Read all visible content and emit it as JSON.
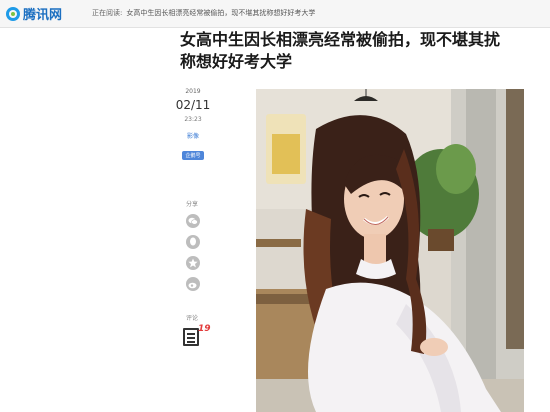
{
  "header": {
    "logo_text": "腾讯网",
    "reading_label": "正在阅读:",
    "reading_title": "女高中生因长相漂亮经常被偷拍，现不堪其扰称想好好考大学"
  },
  "article": {
    "title": "女高中生因长相漂亮经常被偷拍，现不堪其扰称想好好考大学",
    "year": "2019",
    "date": "02/11",
    "time": "23:23",
    "category": "影像",
    "badge": "企鹅号"
  },
  "share": {
    "label": "分享"
  },
  "comments": {
    "label": "评论",
    "count": "19"
  },
  "colors": {
    "brand_blue": "#1b6fc1",
    "accent_red": "#e23b3b",
    "badge_blue": "#4e86da"
  }
}
